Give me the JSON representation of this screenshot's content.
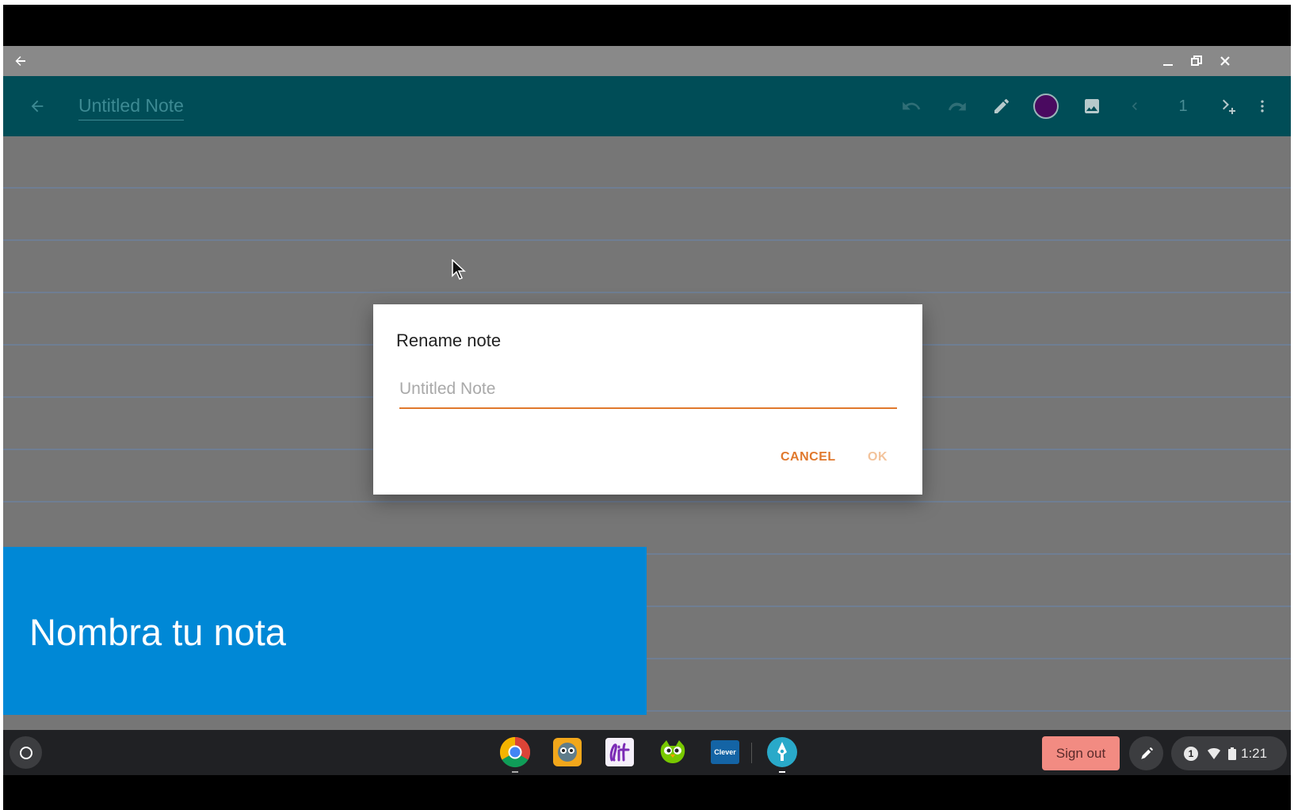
{
  "window": {
    "back_icon": "arrow-left-icon",
    "minimize_icon": "minimize-icon",
    "restore_icon": "restore-icon",
    "close_icon": "close-icon"
  },
  "toolbar": {
    "note_title": "Untitled Note",
    "page_number": "1",
    "pen_color": "#4a0a60",
    "icons": [
      "arrow-left-icon",
      "undo-icon",
      "redo-icon",
      "pencil-icon",
      "color-swatch",
      "image-icon",
      "chevron-left-icon",
      "next-page-add-icon",
      "more-vert-icon"
    ]
  },
  "dialog": {
    "title": "Rename note",
    "input_placeholder": "Untitled Note",
    "input_value": "",
    "cancel_label": "CANCEL",
    "ok_label": "OK",
    "accent_color": "#e0782c"
  },
  "caption": {
    "text": "Nombra tu nota",
    "background": "#0088d6"
  },
  "shelf": {
    "apps": [
      "chrome-icon",
      "owl-reader-icon",
      "lit-icon",
      "duolingo-icon",
      "clever-icon",
      "squid-pen-icon"
    ],
    "clever_label": "Clever",
    "sign_out_label": "Sign out",
    "notification_count": "1",
    "time": "1:21"
  }
}
